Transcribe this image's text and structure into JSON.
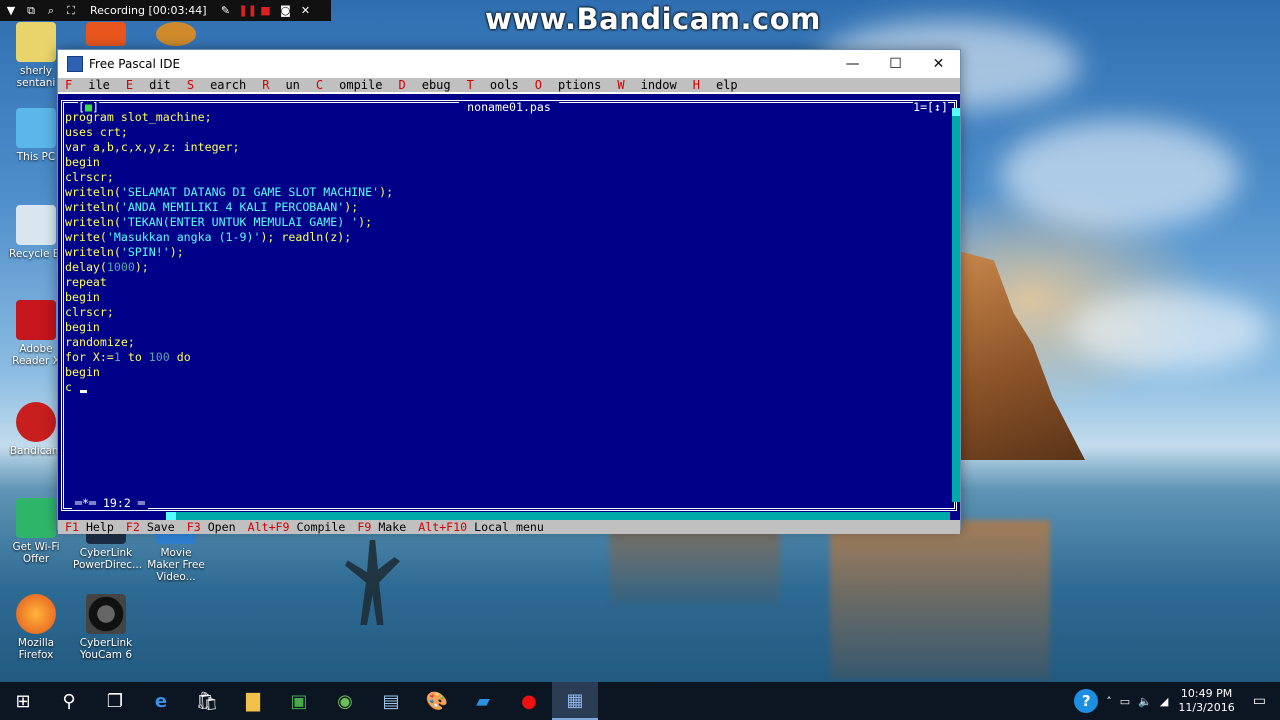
{
  "watermark": "www.Bandicam.com",
  "recorder": {
    "label": "Recording [00:03:44]"
  },
  "desktop_icons": [
    {
      "label": "sherly sentani"
    },
    {
      "label": "This PC"
    },
    {
      "label": "Recycle Bi"
    },
    {
      "label": "Adobe Reader X"
    },
    {
      "label": "Bandicam"
    },
    {
      "label": "Get Wi-Fi Offer"
    },
    {
      "label": "CyberLink PowerDirec..."
    },
    {
      "label": "Movie Maker Free Video..."
    },
    {
      "label": "Mozilla Firefox"
    },
    {
      "label": "CyberLink YouCam 6"
    }
  ],
  "window": {
    "title": "Free Pascal IDE",
    "controls": {
      "minimize": "—",
      "maximize": "☐",
      "close": "✕"
    }
  },
  "menu": [
    "File",
    "Edit",
    "Search",
    "Run",
    "Compile",
    "Debug",
    "Tools",
    "Options",
    "Window",
    "Help"
  ],
  "editor": {
    "filename": "noname01.pas",
    "close_box": "[■]",
    "window_number": "1=[↕]",
    "position": "═*═ 19:2 ═",
    "lines": [
      [
        {
          "t": "program slot_machine;",
          "c": "id"
        }
      ],
      [
        {
          "t": "uses crt;",
          "c": "id"
        }
      ],
      [
        {
          "t": "var a,b,c,x,y,z: integer;",
          "c": "id"
        }
      ],
      [
        {
          "t": "begin",
          "c": "id"
        }
      ],
      [
        {
          "t": "clrscr;",
          "c": "id"
        }
      ],
      [
        {
          "t": "writeln(",
          "c": "id"
        },
        {
          "t": "'SELAMAT DATANG DI GAME SLOT MACHINE'",
          "c": "str"
        },
        {
          "t": ");",
          "c": "id"
        }
      ],
      [
        {
          "t": "writeln(",
          "c": "id"
        },
        {
          "t": "'ANDA MEMILIKI 4 KALI PERCOBAAN'",
          "c": "str"
        },
        {
          "t": ");",
          "c": "id"
        }
      ],
      [
        {
          "t": "writeln(",
          "c": "id"
        },
        {
          "t": "'TEKAN(ENTER UNTUK MEMULAI GAME) '",
          "c": "str"
        },
        {
          "t": ");",
          "c": "id"
        }
      ],
      [
        {
          "t": "write(",
          "c": "id"
        },
        {
          "t": "'Masukkan angka (1-9)'",
          "c": "str"
        },
        {
          "t": "); readln(z);",
          "c": "id"
        }
      ],
      [
        {
          "t": "writeln(",
          "c": "id"
        },
        {
          "t": "'SPIN!'",
          "c": "str"
        },
        {
          "t": ");",
          "c": "id"
        }
      ],
      [
        {
          "t": "delay(",
          "c": "id"
        },
        {
          "t": "1000",
          "c": "num"
        },
        {
          "t": ");",
          "c": "id"
        }
      ],
      [
        {
          "t": "repeat",
          "c": "id"
        }
      ],
      [
        {
          "t": "begin",
          "c": "id"
        }
      ],
      [
        {
          "t": "clrscr;",
          "c": "id"
        }
      ],
      [
        {
          "t": "begin",
          "c": "id"
        }
      ],
      [
        {
          "t": "randomize;",
          "c": "id"
        }
      ],
      [
        {
          "t": "for X:=",
          "c": "id"
        },
        {
          "t": "1",
          "c": "num"
        },
        {
          "t": " to ",
          "c": "id"
        },
        {
          "t": "100",
          "c": "num"
        },
        {
          "t": " do",
          "c": "id"
        }
      ],
      [
        {
          "t": "begin",
          "c": "id"
        }
      ],
      [
        {
          "t": "c ",
          "c": "id"
        }
      ]
    ]
  },
  "status": [
    {
      "key": "F1",
      "label": "Help"
    },
    {
      "key": "F2",
      "label": "Save"
    },
    {
      "key": "F3",
      "label": "Open"
    },
    {
      "key": "Alt+F9",
      "label": "Compile"
    },
    {
      "key": "F9",
      "label": "Make"
    },
    {
      "key": "Alt+F10",
      "label": "Local menu"
    }
  ],
  "taskbar": {
    "clock_time": "10:49 PM",
    "clock_date": "11/3/2016",
    "help_icon": "?"
  },
  "colors": {
    "editor_bg": "#000088",
    "editor_text": "#ffff55",
    "string": "#55ffff",
    "menu_bg": "#c0c0c0",
    "hotkey": "#d00000"
  }
}
